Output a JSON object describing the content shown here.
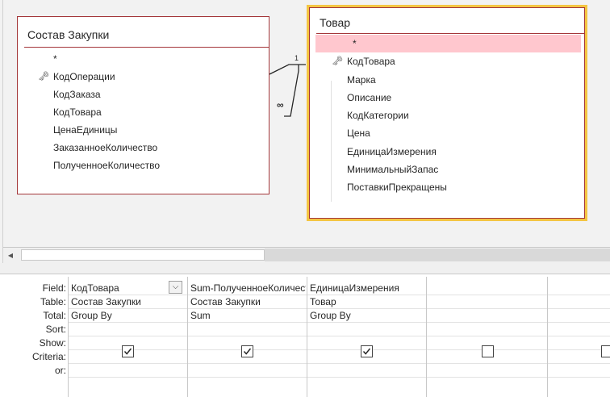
{
  "tables": {
    "zakupki": {
      "title": "Состав Закупки",
      "fields": [
        "*",
        "КодОперации",
        "КодЗаказа",
        "КодТовара",
        "ЦенаЕдиницы",
        "ЗаказанноеКоличество",
        "ПолученноеКоличество"
      ]
    },
    "tovar": {
      "title": "Товар",
      "fields": [
        "*",
        "КодТовара",
        "Марка",
        "Описание",
        "КодКатегории",
        "Цена",
        "ЕдиницаИзмерения",
        "МинимальныйЗапас",
        "ПоставкиПрекращены"
      ]
    }
  },
  "relationship": {
    "one_label": "1",
    "many_label": "∞"
  },
  "grid": {
    "row_labels": [
      "Field:",
      "Table:",
      "Total:",
      "Sort:",
      "Show:",
      "Criteria:",
      "or:"
    ],
    "columns": [
      {
        "field": "КодТовара",
        "table": "Состав Закупки",
        "total": "Group By",
        "show": true
      },
      {
        "field": "Sum-ПолученноеКоличество",
        "table": "Состав Закупки",
        "total": "Sum",
        "show": true
      },
      {
        "field": "ЕдиницаИзмерения",
        "table": "Товар",
        "total": "Group By",
        "show": true
      },
      {
        "field": "",
        "table": "",
        "total": "",
        "show": false
      },
      {
        "field": "",
        "table": "",
        "total": "",
        "show": false
      }
    ]
  },
  "icons": {
    "key": "key-icon",
    "dropdown": "chevron-down-icon",
    "scroll_left": "arrow-left-icon"
  },
  "colors": {
    "table_border": "#a4373a",
    "selected_table": "#f4c542",
    "selected_field": "#ffc7ce"
  }
}
